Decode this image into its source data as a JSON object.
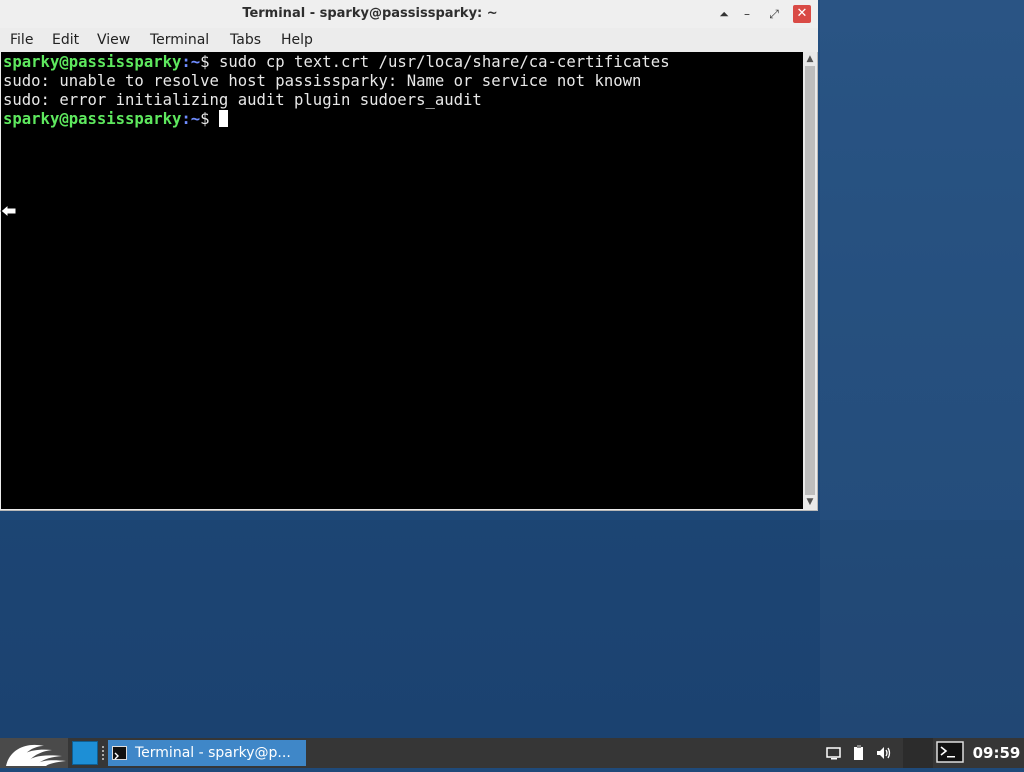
{
  "window": {
    "title": "Terminal - sparky@passissparky: ~",
    "controls": {
      "shade": "⏶",
      "minimize": "–",
      "maximize": "⤢",
      "close": "✕"
    }
  },
  "menubar": [
    "File",
    "Edit",
    "View",
    "Terminal",
    "Tabs",
    "Help"
  ],
  "terminal": {
    "prompt_user": "sparky@passissparky",
    "prompt_path": ":~",
    "prompt_symbol": "$",
    "command": " sudo cp text.crt /usr/loca/share/ca-certificates",
    "output_1": "sudo: unable to resolve host passissparky: Name or service not known",
    "output_2": "sudo: error initializing audit plugin sudoers_audit",
    "active_prompt_user": "sparky@passissparky",
    "active_prompt_path": ":~",
    "active_prompt_symbol": "$ "
  },
  "taskbar": {
    "task_label": "Terminal - sparky@p...",
    "clock": "09:59",
    "icons": [
      "start-menu-icon",
      "desktop-pager-icon",
      "terminal-icon",
      "display-icon",
      "clipboard-icon",
      "volume-icon",
      "terminal-launcher-icon"
    ]
  },
  "colors": {
    "desktop": "#1f4b7b",
    "terminal_bg": "#000000",
    "prompt_user": "#5ee85e",
    "prompt_path": "#6f8cff",
    "taskbar": "#363636",
    "task_active": "#3f87c8",
    "close_button": "#d94a45"
  }
}
